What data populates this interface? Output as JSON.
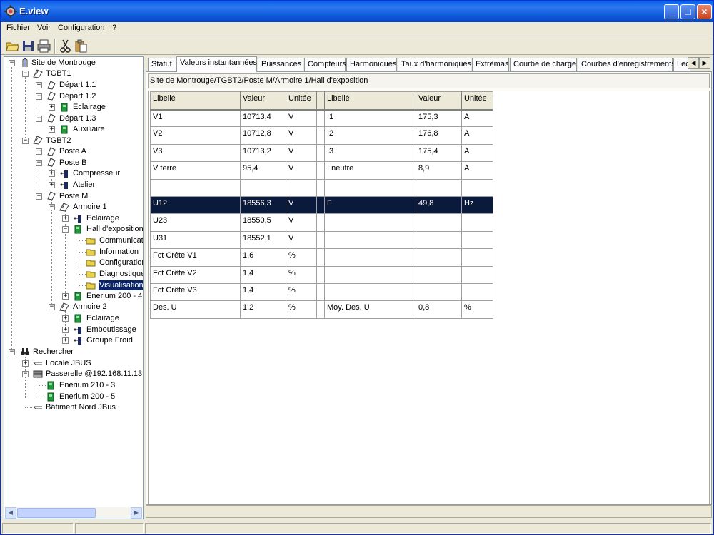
{
  "window": {
    "title": "E.view"
  },
  "menu": {
    "file": "Fichier",
    "view": "Voir",
    "config": "Configuration",
    "help": "?"
  },
  "toolbar": {
    "icons": [
      "open-folder-icon",
      "save-icon",
      "print-icon",
      "cut-icon",
      "paste-icon"
    ]
  },
  "tree": {
    "site": "Site de Montrouge",
    "tgbt1": "TGBT1",
    "depart11": "Départ 1.1",
    "depart12": "Départ 1.2",
    "eclairage1": "Eclairage",
    "depart13": "Départ 1.3",
    "auxiliaire": "Auxiliaire",
    "tgbt2": "TGBT2",
    "posteA": "Poste A",
    "posteB": "Poste B",
    "compresseur": "Compresseur",
    "atelier": "Atelier",
    "posteM": "Poste M",
    "armoire1": "Armoire 1",
    "eclairage2": "Eclairage",
    "hall": "Hall d'exposition",
    "communication": "Communicati",
    "information": "Information",
    "configuration": "Configuratior",
    "diagnostique": "Diagnostique",
    "visualisation": "Visualisation",
    "enerium2004": "Enerium 200 - 4",
    "armoire2": "Armoire 2",
    "eclairage3": "Eclairage",
    "emboutissage": "Emboutissage",
    "groupeFroid": "Groupe Froid",
    "rechercher": "Rechercher",
    "locale": "Locale JBUS",
    "passerelle": "Passerelle @192.168.11.13",
    "enerium2103": "Enerium 210 - 3",
    "enerium2005": "Enerium 200 - 5",
    "batiment": "Bâtiment Nord JBus"
  },
  "tabs": [
    "Statut",
    "Valeurs instantannées",
    "Puissances",
    "Compteurs",
    "Harmoniques",
    "Taux d'harmoniques",
    "Extrêmas",
    "Courbe de charge",
    "Courbes d'enregistrements",
    "Lec"
  ],
  "breadcrumb": "Site de Montrouge/TGBT2/Poste M/Armoire 1/Hall d'exposition",
  "table": {
    "headers": [
      "Libellé",
      "Valeur",
      "Unitée",
      "",
      "Libellé",
      "Valeur",
      "Unitée"
    ],
    "rows": [
      [
        "V1",
        "10713,4",
        "V",
        "",
        "I1",
        "175,3",
        "A"
      ],
      [
        "V2",
        "10712,8",
        "V",
        "",
        "I2",
        "176,8",
        "A"
      ],
      [
        "V3",
        "10713,2",
        "V",
        "",
        "I3",
        "175,4",
        "A"
      ],
      [
        "V terre",
        "95,4",
        "V",
        "",
        "I neutre",
        "8,9",
        "A"
      ],
      [
        "",
        "",
        "",
        "",
        "",
        "",
        ""
      ],
      [
        "U12",
        "18556,3",
        "V",
        "",
        "F",
        "49,8",
        "Hz"
      ],
      [
        "U23",
        "18550,5",
        "V",
        "",
        "",
        "",
        ""
      ],
      [
        "U31",
        "18552,1",
        "V",
        "",
        "",
        "",
        ""
      ],
      [
        "Fct Crête V1",
        "1,6",
        "%",
        "",
        "",
        "",
        ""
      ],
      [
        "Fct Crête V2",
        "1,4",
        "%",
        "",
        "",
        "",
        ""
      ],
      [
        "Fct Crête V3",
        "1,4",
        "%",
        "",
        "",
        "",
        ""
      ],
      [
        "Des. U",
        "1,2",
        "%",
        "",
        "Moy. Des. U",
        "0,8",
        "%"
      ]
    ]
  },
  "colors": {
    "selection": "#0a246a",
    "titlebar": "#0a5fe6"
  }
}
